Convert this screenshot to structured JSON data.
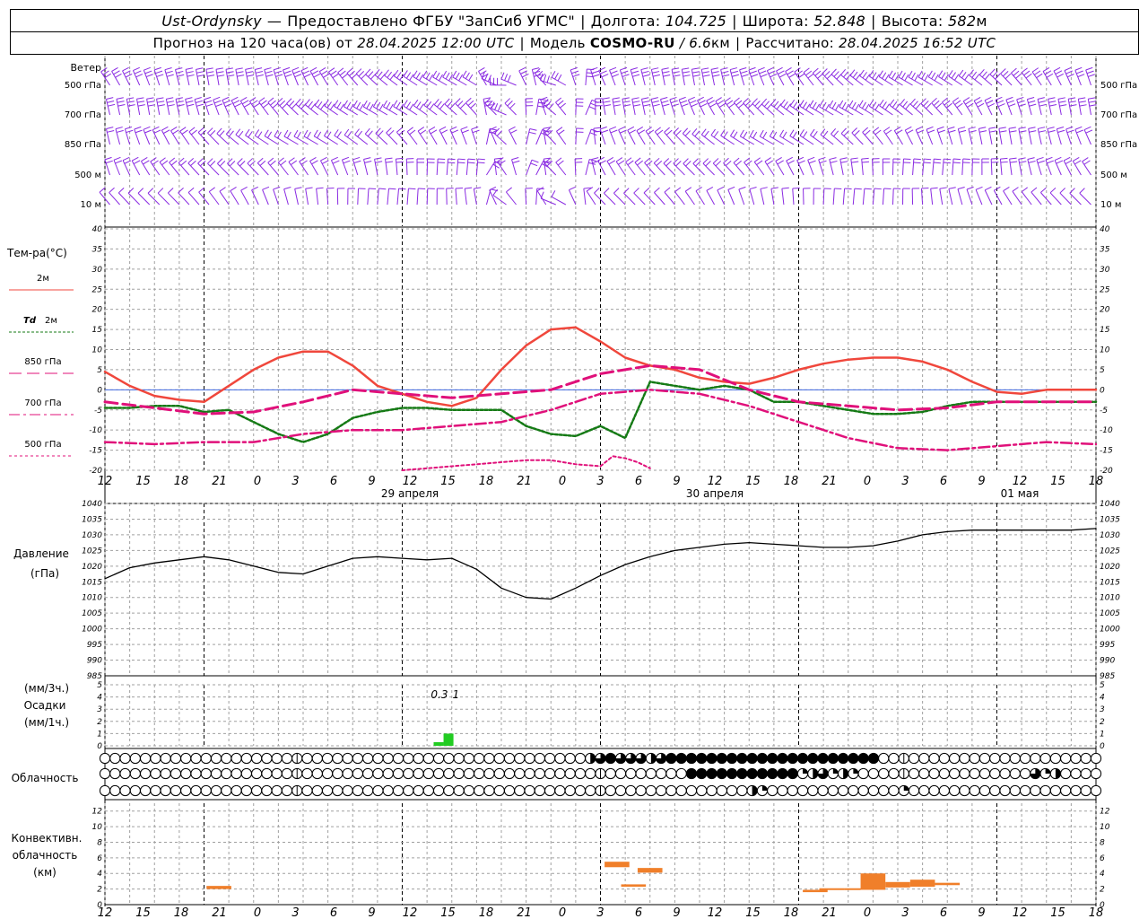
{
  "header": {
    "station": "Ust-Ordynsky",
    "provider_prefix": "—",
    "provider": "Предоставлено ФГБУ \"ЗапСиб УГМС\"",
    "lon_label": "Долгота:",
    "lon_value": "104.725",
    "lat_label": "Широта:",
    "lat_value": "52.848",
    "alt_label": "Высота:",
    "alt_value": "582",
    "alt_unit": "м",
    "forecast_prefix": "Прогноз на 120 часа(ов) от",
    "forecast_start": "28.04.2025 12:00 UTC",
    "model_label": "Модель",
    "model_name": "COSMO-RU",
    "model_res": "/ 6.6",
    "model_res_unit": "км",
    "calc_label": "Рассчитано:",
    "calc_time": "28.04.2025 16:52 UTC"
  },
  "time_axis": {
    "hour_labels": [
      "12",
      "15",
      "18",
      "21",
      "0",
      "3",
      "6",
      "9",
      "12",
      "15",
      "18",
      "21",
      "0",
      "3",
      "6",
      "9",
      "12",
      "15",
      "18",
      "21",
      "0",
      "3",
      "6",
      "9",
      "12",
      "15",
      "18"
    ],
    "date_labels": [
      {
        "index": 8,
        "text": "29 апреля"
      },
      {
        "index": 16,
        "text": "30 апреля"
      },
      {
        "index": 24,
        "text": "01 мая"
      }
    ]
  },
  "wind_panel": {
    "title": "Ветер",
    "levels": [
      "500 гПа",
      "700 гПа",
      "850 гПа",
      "500 м",
      "10  м"
    ],
    "color": "#8a2be2"
  },
  "temp_panel": {
    "title": "Тем-ра(°C)",
    "ylim": [
      -20,
      40
    ],
    "ticks": [
      40,
      35,
      30,
      25,
      20,
      15,
      10,
      5,
      0,
      -5,
      -10,
      -15,
      -20
    ],
    "legend": [
      {
        "key": "t2m",
        "label": "2м",
        "color": "#f0473c",
        "dash": ""
      },
      {
        "key": "td2m",
        "label": "2м",
        "prefix": "Td",
        "color": "#157a15",
        "dash": "3,2"
      },
      {
        "key": "t850",
        "label": "850 гПа",
        "color": "#e0107a",
        "dash": "14,6"
      },
      {
        "key": "t700",
        "label": "700 гПа",
        "color": "#e0107a",
        "dash": "12,4,3,4"
      },
      {
        "key": "t500",
        "label": "500 гПа",
        "color": "#e0107a",
        "dash": "3,3"
      }
    ]
  },
  "pressure_panel": {
    "title": "Давление",
    "unit": "(гПа)",
    "ylim": [
      985,
      1040
    ],
    "ticks": [
      1040,
      1035,
      1030,
      1025,
      1020,
      1015,
      1010,
      1005,
      1000,
      995,
      990,
      985
    ]
  },
  "precip_panel": {
    "unit3": "(мм/3ч.)",
    "title": "Осадки",
    "unit1": "(мм/1ч.)",
    "ticks": [
      5,
      4,
      3,
      2,
      1,
      0
    ],
    "annotations": [
      {
        "hour": 40.5,
        "text": "0.3"
      },
      {
        "hour": 42.5,
        "text": "1"
      }
    ]
  },
  "cloud_panel": {
    "title": "Облачность"
  },
  "convective_panel": {
    "title_1": "Конвективн.",
    "title_2": "облачность",
    "unit": "(км)",
    "ticks": [
      12,
      10,
      8,
      6,
      4,
      2,
      0
    ]
  },
  "chart_data": [
    {
      "type": "line",
      "x_unit": "hours from 28.04.2025 12:00 UTC",
      "xlim": [
        0,
        120
      ],
      "ylabel": "Тем-ра(°C)",
      "ylim": [
        -20,
        40
      ],
      "grid": true,
      "series": [
        {
          "name": "2м",
          "key": "t2m",
          "x": [
            0,
            3,
            6,
            9,
            12,
            15,
            18,
            21,
            24,
            27,
            30,
            33,
            36,
            39,
            42,
            45,
            48,
            51,
            54,
            57,
            60,
            63,
            66,
            69,
            72,
            75,
            78,
            81,
            84,
            87,
            90,
            93,
            96,
            99,
            102,
            105,
            108,
            111,
            114,
            117,
            120
          ],
          "values": [
            4.5,
            1,
            -1.5,
            -2.5,
            -3,
            1,
            5,
            8,
            9.5,
            9.5,
            6,
            1,
            -1,
            -3,
            -4,
            -2,
            5,
            11,
            15,
            15.5,
            12,
            8,
            6,
            5,
            3,
            2,
            1.5,
            3,
            5,
            6.5,
            7.5,
            8,
            8,
            7,
            5,
            2,
            -0.5,
            -1,
            0,
            0,
            0
          ]
        },
        {
          "name": "2м",
          "key": "td2m",
          "x": [
            0,
            3,
            6,
            9,
            12,
            15,
            18,
            21,
            24,
            27,
            30,
            33,
            36,
            39,
            42,
            45,
            48,
            51,
            54,
            57,
            60,
            63,
            66,
            69,
            72,
            75,
            78,
            81,
            84,
            87,
            90,
            93,
            96,
            99,
            102,
            105,
            108,
            111,
            114,
            117,
            120
          ],
          "values": [
            -4.5,
            -4.5,
            -4,
            -4,
            -5.5,
            -5,
            -8,
            -11,
            -13,
            -11,
            -7,
            -5.5,
            -4.5,
            -4.5,
            -5,
            -5,
            -5,
            -9,
            -11,
            -11.5,
            -9,
            -12,
            2,
            1,
            0,
            1,
            0,
            -3,
            -3,
            -4,
            -5,
            -6,
            -6,
            -5.5,
            -4,
            -3,
            -3,
            -3,
            -3,
            -3,
            -3
          ]
        },
        {
          "name": "850 гПа",
          "key": "t850",
          "x": [
            0,
            6,
            12,
            18,
            24,
            30,
            36,
            42,
            48,
            54,
            60,
            66,
            72,
            78,
            84,
            90,
            96,
            102,
            108,
            114,
            120
          ],
          "values": [
            -3,
            -4.5,
            -6,
            -5.5,
            -3,
            0,
            -1,
            -2,
            -1,
            0,
            4,
            6,
            5,
            0,
            -3,
            -4,
            -5,
            -4.5,
            -3,
            -3,
            -3
          ]
        },
        {
          "name": "700 гПа",
          "key": "t700",
          "x": [
            0,
            6,
            12,
            18,
            24,
            30,
            36,
            42,
            48,
            54,
            60,
            66,
            72,
            78,
            84,
            90,
            96,
            102,
            108,
            114,
            120
          ],
          "values": [
            -13,
            -13.5,
            -13,
            -13,
            -11,
            -10,
            -10,
            -9,
            -8,
            -5,
            -1,
            0,
            -1,
            -4,
            -8,
            -12,
            -14.5,
            -15,
            -14,
            -13,
            -13.5
          ]
        },
        {
          "name": "500 гПа",
          "key": "t500",
          "x": [
            36,
            39,
            42,
            45,
            48,
            51,
            54,
            57,
            60,
            61.5,
            63,
            64.5,
            66
          ],
          "values": [
            -20,
            -19.5,
            -19,
            -18.5,
            -18,
            -17.5,
            -17.5,
            -18.5,
            -19,
            -16.5,
            -17,
            -18,
            -19.5
          ]
        }
      ]
    },
    {
      "type": "line",
      "x_unit": "hours from 28.04.2025 12:00 UTC",
      "xlim": [
        0,
        120
      ],
      "ylabel": "Давление",
      "ylim": [
        985,
        1040
      ],
      "grid": true,
      "series": [
        {
          "name": "",
          "key": "pres",
          "x": [
            0,
            3,
            6,
            9,
            12,
            15,
            18,
            21,
            24,
            27,
            30,
            33,
            36,
            39,
            42,
            45,
            48,
            51,
            54,
            57,
            60,
            63,
            66,
            69,
            72,
            75,
            78,
            81,
            84,
            87,
            90,
            93,
            96,
            99,
            102,
            105,
            108,
            111,
            114,
            117,
            120
          ],
          "values": [
            1016,
            1019.5,
            1021,
            1022,
            1023,
            1022,
            1020,
            1018,
            1017.5,
            1020,
            1022.5,
            1023,
            1022.5,
            1022,
            1022.5,
            1019,
            1013,
            1010,
            1009.5,
            1013,
            1017,
            1020.5,
            1023,
            1025,
            1026,
            1027,
            1027.5,
            1027,
            1026.5,
            1026,
            1026,
            1026.5,
            1028,
            1030,
            1031,
            1031.5,
            1031.5,
            1031.5,
            1031.5,
            1031.5,
            1032
          ]
        }
      ]
    },
    {
      "type": "bar",
      "x_unit": "hours from 28.04.2025 12:00 UTC",
      "ylabel": "Осадки",
      "ylim": [
        0,
        5
      ],
      "bars": [
        {
          "x0": 39.8,
          "x1": 41,
          "value": 0.3
        },
        {
          "x0": 41,
          "x1": 42.2,
          "value": 1
        }
      ]
    },
    {
      "type": "table",
      "name": "Облачность",
      "rows": [
        "upper",
        "middle",
        "lower"
      ],
      "x_step_hours": 1.2,
      "cells_count": 99,
      "values": {
        "upper": {
          "default": 0,
          "ranges": [
            [
              48,
              1,
              "h"
            ],
            [
              49,
              1,
              "t"
            ],
            [
              50,
              1,
              "f"
            ],
            [
              51,
              3,
              "t"
            ],
            [
              54,
              1,
              "h"
            ],
            [
              55,
              1,
              "t"
            ],
            [
              56,
              21,
              "f"
            ]
          ]
        },
        "middle": {
          "default": 0,
          "ranges": [
            [
              58,
              11,
              "f"
            ],
            [
              69,
              1,
              "q"
            ],
            [
              70,
              1,
              "h"
            ],
            [
              71,
              1,
              "t"
            ],
            [
              72,
              1,
              "q"
            ],
            [
              73,
              1,
              "h"
            ],
            [
              74,
              1,
              "q"
            ],
            [
              92,
              1,
              "t"
            ],
            [
              93,
              1,
              "q"
            ],
            [
              94,
              1,
              "h"
            ]
          ]
        },
        "lower": {
          "default": 0,
          "ranges": [
            [
              64,
              1,
              "h"
            ],
            [
              65,
              1,
              "q"
            ],
            [
              79,
              1,
              "q"
            ]
          ]
        }
      }
    },
    {
      "type": "bar",
      "name": "Конвективн. облачность",
      "ylim": [
        0,
        13
      ],
      "segments": [
        {
          "x0": 12.3,
          "x1": 15.3,
          "bottom": 2.0,
          "top": 2.4
        },
        {
          "x0": 60.5,
          "x1": 63.5,
          "bottom": 4.8,
          "top": 5.5
        },
        {
          "x0": 62.5,
          "x1": 65.5,
          "bottom": 2.3,
          "top": 2.6
        },
        {
          "x0": 64.5,
          "x1": 67.5,
          "bottom": 4.1,
          "top": 4.7
        },
        {
          "x0": 84.5,
          "x1": 87.5,
          "bottom": 1.6,
          "top": 1.9
        },
        {
          "x0": 86.5,
          "x1": 89.5,
          "bottom": 1.9,
          "top": 2.1
        },
        {
          "x0": 89.5,
          "x1": 91.5,
          "bottom": 1.9,
          "top": 2.1
        },
        {
          "x0": 91.5,
          "x1": 94.5,
          "bottom": 1.9,
          "top": 4.0
        },
        {
          "x0": 94.5,
          "x1": 97.5,
          "bottom": 2.2,
          "top": 2.9
        },
        {
          "x0": 97.5,
          "x1": 100.5,
          "bottom": 2.3,
          "top": 3.2
        },
        {
          "x0": 100.5,
          "x1": 103.5,
          "bottom": 2.5,
          "top": 2.8
        }
      ]
    }
  ],
  "colors": {
    "wind": "#8a2be2",
    "grid": "#a0a0a0",
    "zero_line": "#4169e1",
    "precip": "#22cc22",
    "convective": "#f07f2a"
  }
}
